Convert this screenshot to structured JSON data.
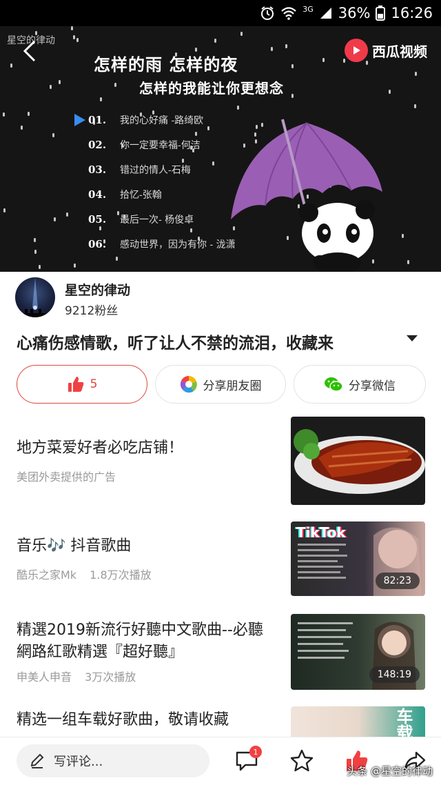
{
  "status_bar": {
    "battery": "36%",
    "time": "16:26",
    "network": "3G"
  },
  "video": {
    "watermark": "星空的律动",
    "brand": "西瓜视频",
    "title_line1": "怎样的雨 怎样的夜",
    "title_line2": "怎样的我能让你更想念",
    "playlist": [
      {
        "num": "01.",
        "title": "我的心好痛 -路绮欧",
        "playing": true
      },
      {
        "num": "02.",
        "title": "你一定要幸福-何洁"
      },
      {
        "num": "03.",
        "title": "错过的情人-石梅"
      },
      {
        "num": "04.",
        "title": "拾忆-张翰"
      },
      {
        "num": "05.",
        "title": "最后一次- 杨俊卓"
      },
      {
        "num": "06.",
        "title": "感动世界，因为有你 - 泷潇"
      }
    ]
  },
  "author": {
    "name": "星空的律动",
    "fans": "9212粉丝"
  },
  "video_title": "心痛伤感情歌，听了让人不禁的流泪，收藏来",
  "actions": {
    "like_count": "5",
    "share_moments": "分享朋友圈",
    "share_wechat": "分享微信"
  },
  "feed": [
    {
      "title": "地方菜爱好者必吃店铺！",
      "source": "美团外卖提供的广告",
      "views": "",
      "duration": ""
    },
    {
      "title": "音乐🎶 抖音歌曲",
      "source": "酷乐之家Mk",
      "views": "1.8万次播放",
      "duration": "82:23",
      "thumb_text": "TikTok"
    },
    {
      "title": "精選2019新流行好聽中文歌曲--必聽網路紅歌精選『超好聽』",
      "source": "申美人申音",
      "views": "3万次播放",
      "duration": "148:19"
    },
    {
      "title": "精选一组车载好歌曲，敬请收藏",
      "source": "",
      "views": "",
      "duration": "",
      "thumb_text": "车载"
    }
  ],
  "bottom_bar": {
    "comment_placeholder": "写评论...",
    "comment_badge": "1",
    "watermark": "头条 @星空的律动"
  },
  "colors": {
    "accent_red": "#e0443e",
    "video_bg": "#151515",
    "umbrella": "#9a5fb4"
  }
}
